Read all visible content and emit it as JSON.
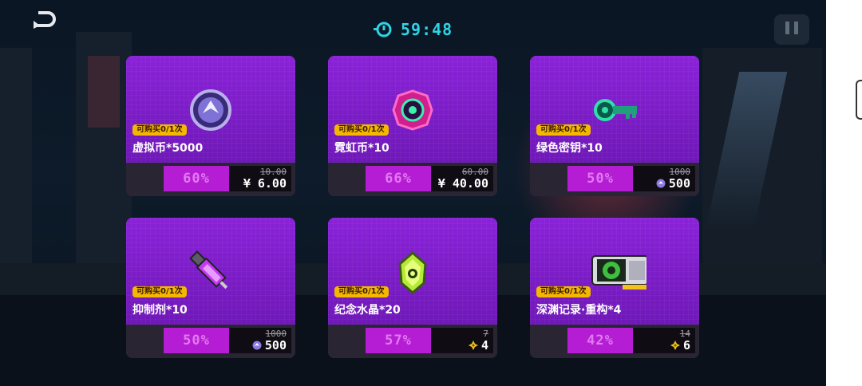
{
  "timer": {
    "value": "59:48",
    "icon": "clock-icon"
  },
  "controls": {
    "back_icon": "back-arrow-icon",
    "pause_icon": "pause-icon"
  },
  "colors": {
    "card": "#7a1ec4",
    "discount_bg": "#b41dd4",
    "limit_badge": "#f5b800",
    "timer": "#2fd3e6"
  },
  "items": [
    {
      "name": "虚拟币*5000",
      "limit": "可购买0/1次",
      "discount": "60%",
      "original": "10.00",
      "price": "¥ 6.00",
      "icon": "virtual-coin-icon",
      "currency": "rmb"
    },
    {
      "name": "霓虹币*10",
      "limit": "可购买0/1次",
      "discount": "66%",
      "original": "60.00",
      "price": "¥ 40.00",
      "icon": "neon-coin-icon",
      "currency": "rmb"
    },
    {
      "name": "绿色密钥*10",
      "limit": "可购买0/1次",
      "discount": "50%",
      "original": "1000",
      "price": "500",
      "icon": "green-key-icon",
      "currency": "virtual-coin"
    },
    {
      "name": "抑制剂*10",
      "limit": "可购买0/1次",
      "discount": "50%",
      "original": "1000",
      "price": "500",
      "icon": "inhibitor-syringe-icon",
      "currency": "virtual-coin"
    },
    {
      "name": "纪念水晶*20",
      "limit": "可购买0/1次",
      "discount": "57%",
      "original": "7",
      "price": "4",
      "icon": "memorial-crystal-icon",
      "currency": "gold-star"
    },
    {
      "name": "深渊记录·重构*4",
      "limit": "可购买0/1次",
      "discount": "42%",
      "original": "14",
      "price": "6",
      "icon": "abyss-record-chip-icon",
      "currency": "gold-star"
    }
  ]
}
